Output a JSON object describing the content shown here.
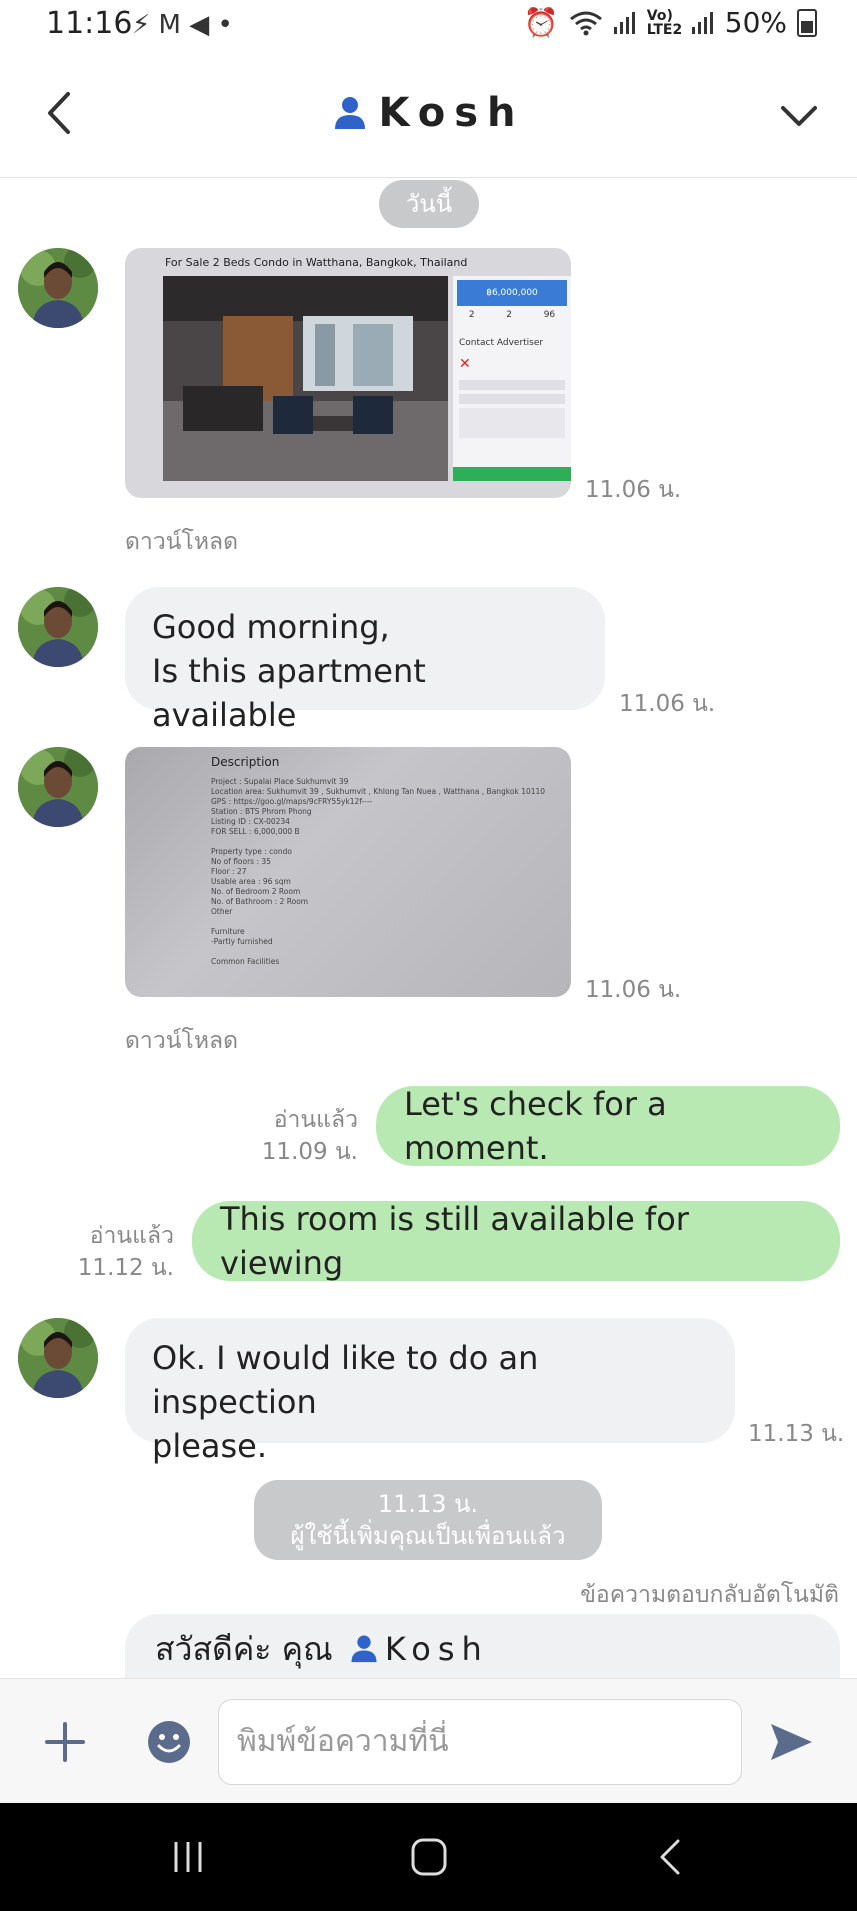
{
  "status_bar": {
    "time": "11:16",
    "notif_icons": "⚡ M ◀ •",
    "signal_text": "Vo) LTE2",
    "battery": "50%"
  },
  "header": {
    "title": "Kosh"
  },
  "chat": {
    "date_pill": "วันนี้",
    "image1": {
      "listing_title": "For Sale 2 Beds Condo in Watthana, Bangkok, Thailand",
      "price": "฿6,000,000",
      "beds": "2",
      "baths": "2",
      "size": "96",
      "contact_heading": "Contact Advertiser",
      "time": "11.06 น.",
      "download": "ดาวน์โหลด"
    },
    "msg1": {
      "line1": "Good morning,",
      "line2": "Is this apartment available",
      "time": "11.06 น."
    },
    "image2": {
      "heading": "Description",
      "lines": [
        "Project : Supalai Place Sukhumvit 39",
        "Location area: Sukhumvit 39 , Sukhumvit , Khlong Tan Nuea , Watthana , Bangkok 10110",
        "GPS : https://goo.gl/maps/9cFRY55yk12f----",
        "Station : BTS Phrom Phong",
        "Listing ID : CX-00234",
        "FOR SELL : 6,000,000 B",
        "",
        "Property type : condo",
        "No of floors : 35",
        "Floor : 27",
        "Usable area : 96 sqm",
        "No. of Bedroom 2 Room",
        "No. of Bathroom : 2 Room",
        "Other",
        "",
        "Furniture",
        "-Partly furnished",
        "",
        "Common Facilities"
      ],
      "time": "11.06 น.",
      "download": "ดาวน์โหลด"
    },
    "out1": {
      "read": "อ่านแล้ว",
      "time": "11.09 น.",
      "text": "Let's check for a moment."
    },
    "out2": {
      "read": "อ่านแล้ว",
      "time": "11.12 น.",
      "text": "This room is still available for viewing"
    },
    "msg2": {
      "line1": "Ok. I would like to do an inspection",
      "line2": "please.",
      "time": "11.13 น."
    },
    "system": {
      "time": "11.13 น.",
      "text": "ผู้ใช้นี้เพิ่มคุณเป็นเพื่อนแล้ว"
    },
    "auto_reply_label": "ข้อความตอบกลับอัตโนมัติ",
    "auto_reply": {
      "greeting": "สวัสดีค่ะ คุณ",
      "name": "Kosh"
    }
  },
  "input_bar": {
    "placeholder": "พิมพ์ข้อความที่นี่"
  },
  "colors": {
    "outgoing": "#b9e9b3",
    "incoming": "#f0f1f3",
    "accent": "#3a63c7",
    "icon": "#5b6b8c"
  }
}
